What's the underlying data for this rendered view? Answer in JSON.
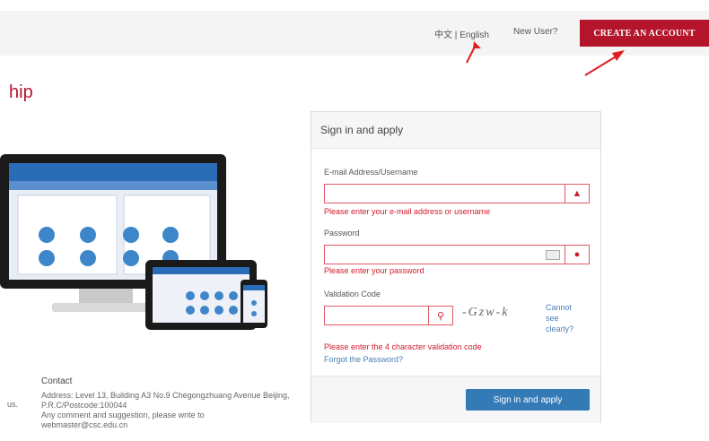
{
  "header": {
    "language": "中文 | English",
    "new_user": "New User?",
    "create_account": "CREATE AN ACCOUNT"
  },
  "page_title": "hip",
  "login": {
    "title": "Sign in and apply",
    "email_label": "E-mail Address/Username",
    "email_value": "",
    "email_error": "Please enter your e-mail address or username",
    "password_label": "Password",
    "password_value": "",
    "password_error": "Please enter your password",
    "code_label": "Validation Code",
    "code_value": "",
    "captcha_text": "-Gzw-k",
    "cannot_see": "Cannot see clearly?",
    "code_error": "Please enter the 4 character validation code",
    "forgot": "Forgot the Password?",
    "submit": "Sign in and apply"
  },
  "contact": {
    "heading": "Contact",
    "address": "Address: Level 13, Building A3 No.9 Chegongzhuang Avenue Beijing, P.R.C/Postcode:100044",
    "comment": "Any comment and suggestion, please write to webmaster@csc.edu.cn",
    "left_stub": "us."
  },
  "colors": {
    "brand_red": "#b4152b",
    "error_red": "#d11b2c",
    "link_blue": "#4a7fb5",
    "button_blue": "#337ab7"
  }
}
